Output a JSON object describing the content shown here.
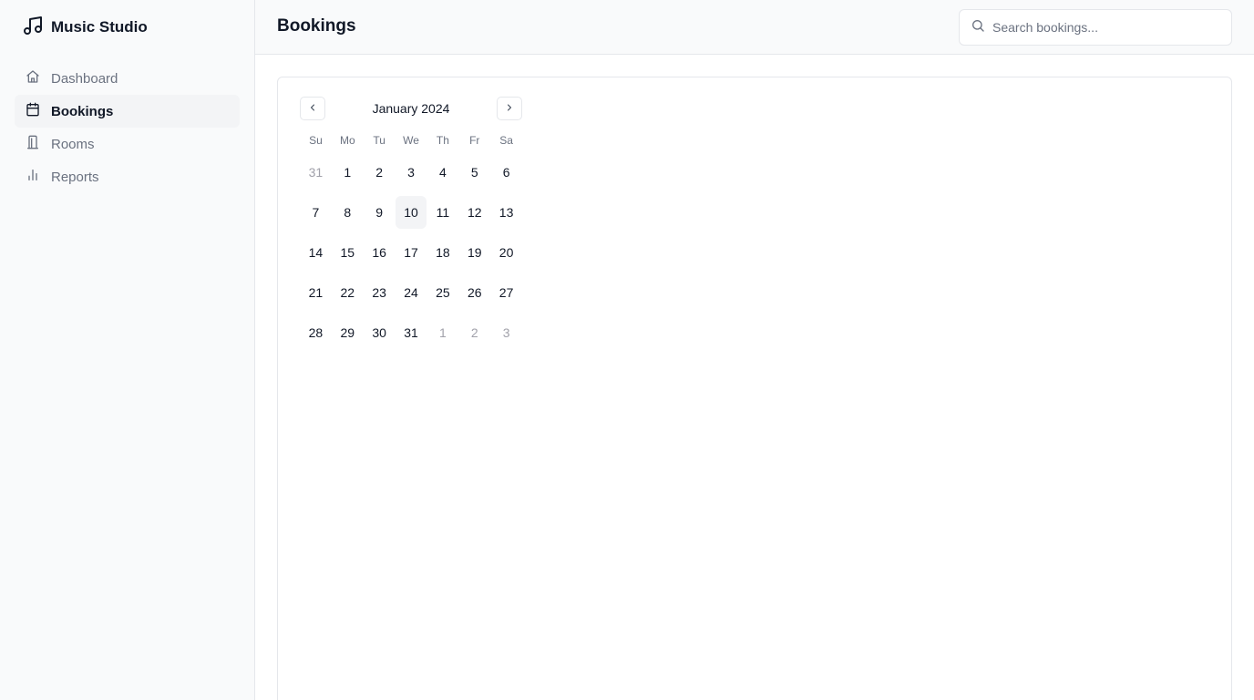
{
  "app": {
    "title": "Music Studio"
  },
  "sidebar": {
    "items": [
      {
        "label": "Dashboard",
        "icon": "home-icon"
      },
      {
        "label": "Bookings",
        "icon": "calendar-icon",
        "active": true
      },
      {
        "label": "Rooms",
        "icon": "building-icon"
      },
      {
        "label": "Reports",
        "icon": "bar-chart-icon"
      }
    ]
  },
  "header": {
    "title": "Bookings",
    "search": {
      "placeholder": "Search bookings...",
      "value": ""
    }
  },
  "calendar": {
    "month_label": "January 2024",
    "weekdays": [
      "Su",
      "Mo",
      "Tu",
      "We",
      "Th",
      "Fr",
      "Sa"
    ],
    "weeks": [
      [
        "31",
        "1",
        "2",
        "3",
        "4",
        "5",
        "6"
      ],
      [
        "7",
        "8",
        "9",
        "10",
        "11",
        "12",
        "13"
      ],
      [
        "14",
        "15",
        "16",
        "17",
        "18",
        "19",
        "20"
      ],
      [
        "21",
        "22",
        "23",
        "24",
        "25",
        "26",
        "27"
      ],
      [
        "28",
        "29",
        "30",
        "31",
        "1",
        "2",
        "3"
      ]
    ],
    "outside_days": [
      [
        0,
        0
      ],
      [
        4,
        4
      ],
      [
        4,
        5
      ],
      [
        4,
        6
      ]
    ],
    "today": [
      1,
      3
    ]
  },
  "colors": {
    "accent": "#111827",
    "muted": "#6b7280",
    "border": "#e5e7eb",
    "sidebar_bg": "#f9fafb",
    "active_bg": "#f3f4f6"
  }
}
